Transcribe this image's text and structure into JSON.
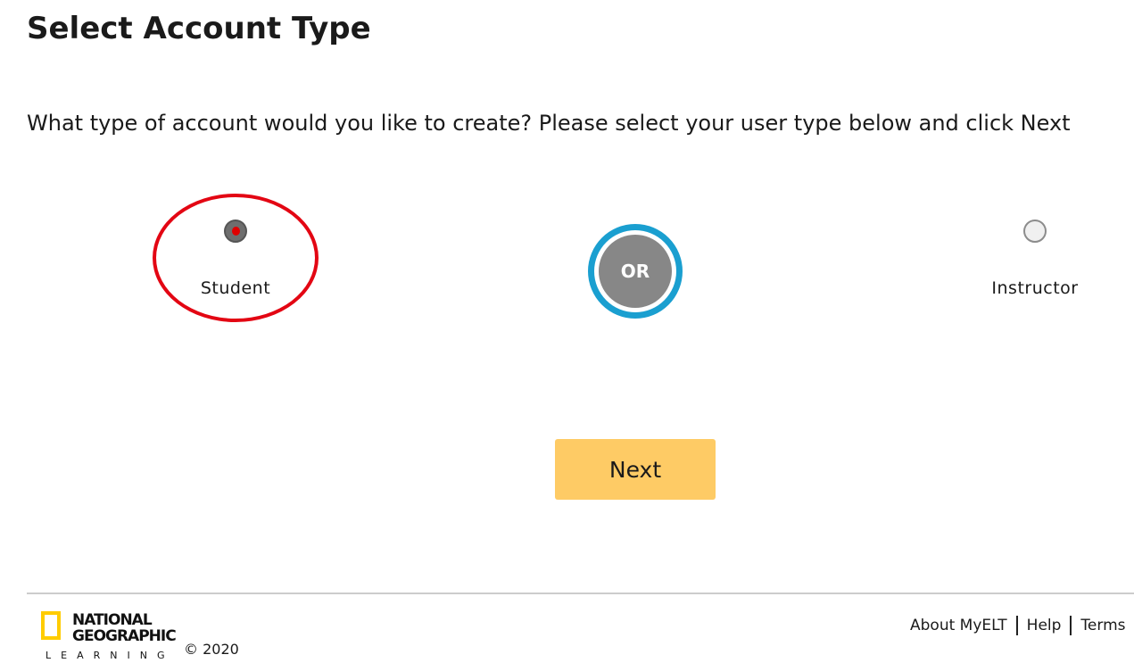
{
  "page": {
    "title": "Select Account Type",
    "prompt": "What type of account would you like to create? Please select your user type below and click Next"
  },
  "options": [
    {
      "label": "Student",
      "selected": true
    },
    {
      "label": "Instructor",
      "selected": false
    }
  ],
  "or_badge": "OR",
  "next_button": "Next",
  "footer": {
    "logo": {
      "line1": "NATIONAL",
      "line2": "GEOGRAPHIC",
      "line3": "LEARNING"
    },
    "copyright": "© 2020",
    "links": [
      "About MyELT",
      "Help",
      "Terms"
    ]
  },
  "colors": {
    "highlight": "#e30613",
    "or_ring": "#1a9fd0",
    "or_core": "#878787",
    "next_button": "#fecb65",
    "logo_frame": "#ffcc00"
  }
}
